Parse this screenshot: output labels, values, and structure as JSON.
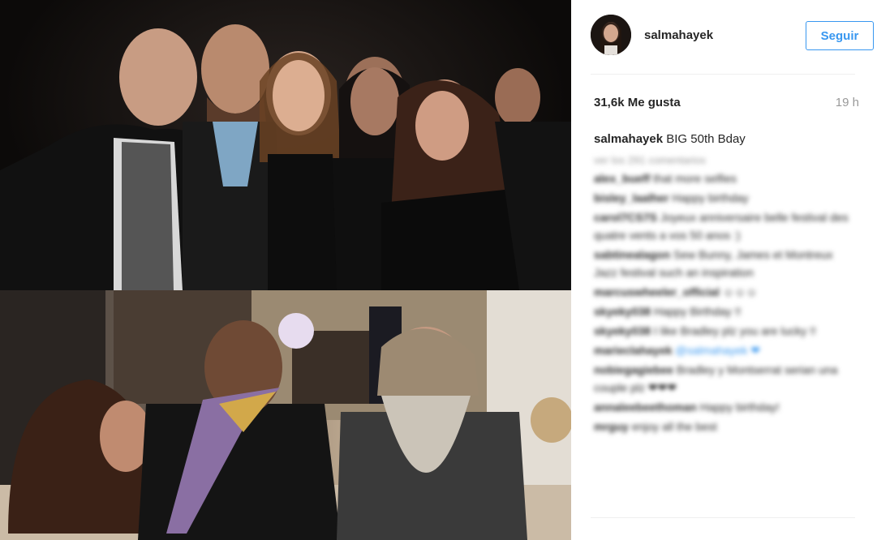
{
  "post": {
    "username": "salmahayek",
    "follow_label": "Seguir",
    "likes": "31,6k Me gusta",
    "time_ago": "19 h",
    "caption": {
      "user": "salmahayek",
      "text": "BIG 50th Bday"
    }
  },
  "comments": {
    "load_more": "ver los 291 comentarios",
    "items": [
      {
        "user": "alex_bueff",
        "text": "that more selfies"
      },
      {
        "user": "bisley_laalher",
        "text": "Happy birthday"
      },
      {
        "user": "carol7CS7S",
        "text": "Joyeux anniversaire belle festival des quatre vents a vos 50 anos :)"
      },
      {
        "user": "sabtinealagon",
        "text": "Sew Bunny, James et Montreux Jazz festival such an inspiration"
      },
      {
        "user": "marcuswheeler_official",
        "text": "☺☺☺"
      },
      {
        "user": "skyeky038",
        "text": "Happy Birthday !!"
      },
      {
        "user": "skyeky038",
        "text": "I like Bradley plz you are lucky !!"
      },
      {
        "user": "marieclahayek",
        "text": "@salmahayek ❤"
      },
      {
        "user": "nobiegagiebee",
        "text": "Bradley y Montserrat serian una couple plz ❤❤❤"
      },
      {
        "user": "annaleebeethoman",
        "text": "Happy birthday!"
      },
      {
        "user": "mrguy",
        "text": "enjoy all the best"
      }
    ]
  },
  "colors": {
    "accent": "#3897f0",
    "text": "#262626",
    "muted": "#999999"
  }
}
